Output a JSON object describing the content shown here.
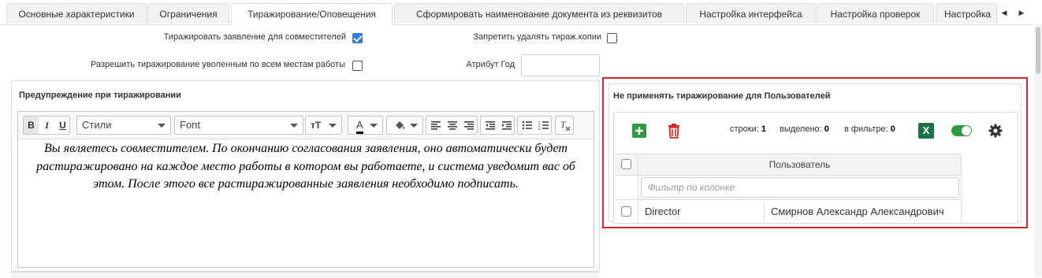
{
  "tabs": [
    {
      "label": "Основные характеристики",
      "active": false
    },
    {
      "label": "Ограничения",
      "active": false
    },
    {
      "label": "Тиражирование/Оповещения",
      "active": true
    },
    {
      "label": "Сформировать наименование документа из реквизитов",
      "active": false
    },
    {
      "label": "Настройка интерфейса",
      "active": false
    },
    {
      "label": "Настройка проверок",
      "active": false
    },
    {
      "label": "Настройка",
      "active": false
    }
  ],
  "settings": {
    "replicate_concurrent_label": "Тиражировать заявление для совместителей",
    "replicate_concurrent_checked": true,
    "forbid_delete_label": "Запретить удалять тираж.копии",
    "forbid_delete_checked": false,
    "allow_dismissed_label": "Разрешить тиражирование уволенным по всем местам работы",
    "allow_dismissed_checked": false,
    "year_attr_label": "Атрибут Год",
    "year_attr_value": ""
  },
  "warning": {
    "title": "Предупреждение при тиражировании",
    "toolbar": {
      "bold": "B",
      "italic": "I",
      "underline": "U",
      "styles_label": "Стили",
      "font_label": "Font",
      "size_icon": "ᴛT",
      "text_color_icon": "A"
    },
    "text": "Вы являетесь совместителем. По окончанию согласования заявления, оно автоматически будет растиражировано на каждое место работы в котором вы работаете, и система уведомит вас об этом. После этого все растиражированные заявления необходимо подписать."
  },
  "users": {
    "title": "Не применять тиражирование для Пользователей",
    "rows_label": "строки:",
    "rows_value": "1",
    "selected_label": "выделено:",
    "selected_value": "0",
    "filter_label": "в фильтре:",
    "filter_value": "0",
    "excel_icon": "X",
    "column_header": "Пользователь",
    "filter_placeholder": "Фильтр по колонке",
    "rows": [
      {
        "login": "Director",
        "name": "Смирнов Александр Александрович"
      }
    ],
    "colors": {
      "add": "#2e9c3e",
      "delete": "#d9262c",
      "excel": "#1e7145",
      "toggle": "#2e9c3e",
      "highlight_border": "#d9262c"
    }
  }
}
